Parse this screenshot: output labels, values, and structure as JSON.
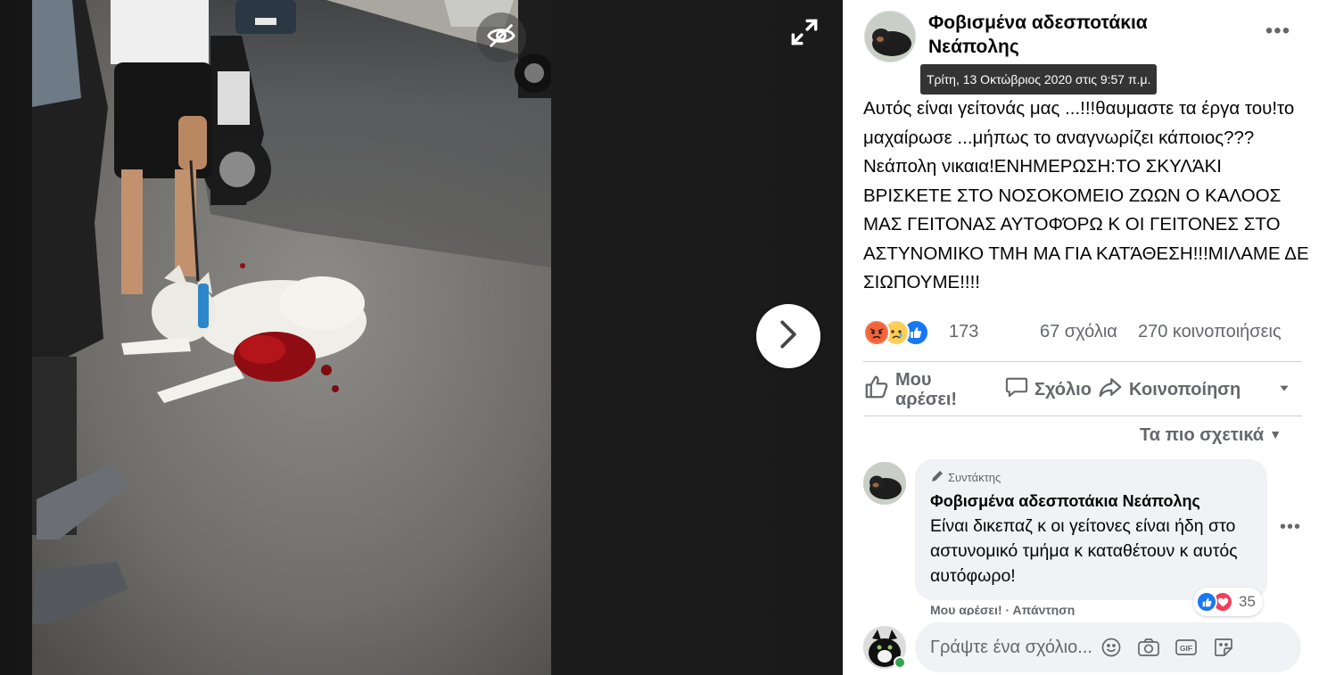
{
  "viewer": {
    "hide_icon": "eye-off-icon",
    "expand_icon": "expand-icon",
    "next_icon": "chevron-right-icon"
  },
  "post": {
    "page_name": "Φοβισμένα αδεσποτάκια Νεάπολης",
    "timestamp_tooltip": "Τρίτη, 13 Οκτώβριος 2020 στις 9:57 π.μ.",
    "text": "Αυτός είναι γείτονάς μας ...!!!θαυμαστε τα έργα του!το μαχαίρωσε ...μήπως το αναγνωρίζει κάποιος???Νεάπολη νικαια!ΕΝΗΜΕΡΩΣΗ:ΤΟ ΣΚΥΛΆΚΙ ΒΡΙΣΚΕΤΕ ΣΤΟ ΝΟΣΟΚΟΜΕΙΟ ΖΩΩΝ Ο ΚΑΛΟΟΣ ΜΑΣ ΓΕΙΤΟΝΑΣ ΑΥΤΟΦΌΡΩ Κ ΟΙ ΓΕΙΤΟΝΕΣ ΣΤΟ ΑΣΤΥΝΟΜΙΚΟ ΤΜΗ ΜΑ ΓΙΑ ΚΑΤΆΘΕΣΗ!!!ΜΙΛΑΜΕ ΔΕ ΣΙΩΠΟΥΜΕ!!!!",
    "reaction_count": "173",
    "comments_count": "67 σχόλια",
    "shares_count": "270 κοινοποιήσεις",
    "reaction_icons": [
      "angry-icon",
      "sad-icon",
      "like-icon"
    ]
  },
  "actions": {
    "like": "Μου αρέσει!",
    "comment": "Σχόλιο",
    "share": "Κοινοποίηση"
  },
  "comments": {
    "sort_label": "Τα πιο σχετικά",
    "items": [
      {
        "badge": "Συντάκτης",
        "author": "Φοβισμένα αδεσποτάκια Νεάπολης",
        "text": "Είναι δικεπαζ κ οι γείτονες είναι ήδη στο αστυνομικό τμήμα κ καταθέτουν κ αυτός αυτόφωρο!",
        "reaction_count": "35",
        "like_label": "Μου αρέσει!",
        "reply_label": "Απάντηση"
      }
    ],
    "composer_placeholder": "Γράψτε ένα σχόλιο..."
  },
  "colors": {
    "secondary_text": "#65676b",
    "bubble_bg": "#f0f2f5",
    "like_blue": "#1877f2",
    "love_red": "#f33e58",
    "online_green": "#31a24c"
  }
}
